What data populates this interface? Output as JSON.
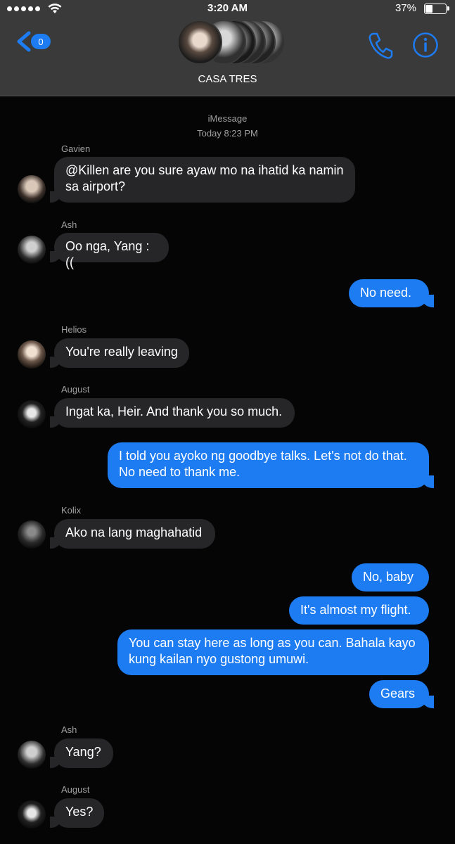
{
  "status_bar": {
    "time": "3:20 AM",
    "battery_percent": "37%",
    "battery_level": 0.37
  },
  "header": {
    "back_badge": "0",
    "group_name": "CASA TRES"
  },
  "thread": {
    "service": "iMessage",
    "timestamp": "Today 8:23 PM",
    "messages": [
      {
        "sender": "Gavien",
        "text": "@Killen are you sure ayaw mo na ihatid ka namin sa airport?",
        "direction": "in"
      },
      {
        "sender": "Ash",
        "text": "Oo nga, Yang :((",
        "direction": "in"
      },
      {
        "text": "No need.",
        "direction": "out"
      },
      {
        "sender": "Helios",
        "text": "You're really leaving",
        "direction": "in"
      },
      {
        "sender": "August",
        "text": "Ingat ka, Heir. And thank you so much.",
        "direction": "in"
      },
      {
        "text": "I told you ayoko ng goodbye talks. Let's not do that. No need to thank me.",
        "direction": "out"
      },
      {
        "sender": "Kolix",
        "text": "Ako na lang maghahatid",
        "direction": "in"
      },
      {
        "text": "No, baby",
        "direction": "out"
      },
      {
        "text": "It's almost my flight.",
        "direction": "out"
      },
      {
        "text": "You can stay here as long as you can. Bahala kayo kung kailan nyo gustong umuwi.",
        "direction": "out"
      },
      {
        "text": "Gears",
        "direction": "out"
      },
      {
        "sender": "Ash",
        "text": "Yang?",
        "direction": "in"
      },
      {
        "sender": "August",
        "text": "Yes?",
        "direction": "in"
      }
    ]
  },
  "colors": {
    "outgoing_bubble": "#1d7cf2",
    "incoming_bubble": "#262628",
    "header_bg": "#3a3a3a",
    "accent": "#1d7cf2"
  },
  "icons": [
    "back-chevron-icon",
    "phone-icon",
    "info-icon",
    "wifi-icon",
    "battery-icon"
  ]
}
